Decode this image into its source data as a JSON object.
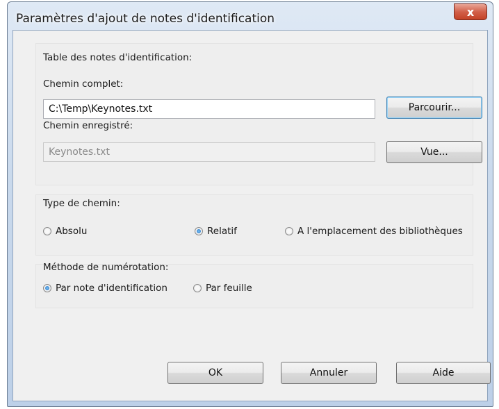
{
  "dialog": {
    "title": "Paramètres d'ajout de notes d'identification",
    "close_glyph": "x"
  },
  "table_group": {
    "label": "Table des notes d'identification:",
    "full_path_label": "Chemin complet:",
    "full_path_value": "C:\\Temp\\Keynotes.txt",
    "browse_label": "Parcourir...",
    "saved_path_label": "Chemin enregistré:",
    "saved_path_value": "Keynotes.txt",
    "view_label": "Vue..."
  },
  "path_type": {
    "label": "Type de chemin:",
    "options": [
      {
        "label": "Absolu",
        "selected": false
      },
      {
        "label": "Relatif",
        "selected": true
      },
      {
        "label": "A l'emplacement des bibliothèques",
        "selected": false
      }
    ]
  },
  "numbering": {
    "label": "Méthode de numérotation:",
    "options": [
      {
        "label": "Par note d'identification",
        "selected": true
      },
      {
        "label": "Par feuille",
        "selected": false
      }
    ]
  },
  "buttons": {
    "ok": "OK",
    "cancel": "Annuler",
    "help": "Aide"
  }
}
